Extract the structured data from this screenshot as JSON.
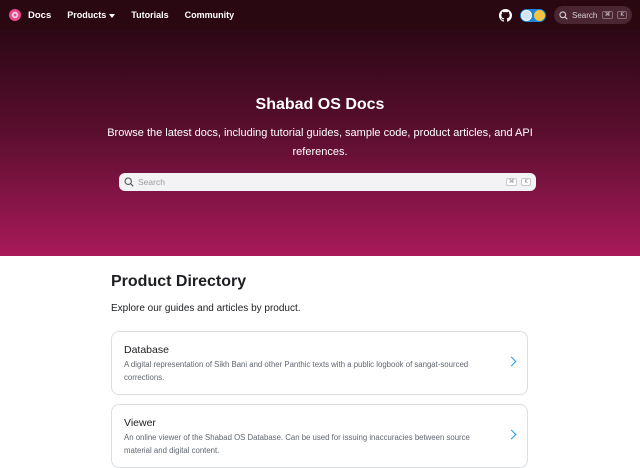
{
  "navbar": {
    "brand": "Docs",
    "items": [
      {
        "label": "Products"
      },
      {
        "label": "Tutorials"
      },
      {
        "label": "Community"
      }
    ],
    "search_placeholder": "Search",
    "search_keys": [
      "⌘",
      "K"
    ]
  },
  "hero": {
    "title": "Shabad OS Docs",
    "subtitle": "Browse the latest docs, including tutorial guides, sample code, product articles, and API references.",
    "search_placeholder": "Search",
    "search_keys": [
      "⌘",
      "K"
    ]
  },
  "directory": {
    "title": "Product Directory",
    "subtitle": "Explore our guides and articles by product.",
    "cards": [
      {
        "title": "Database",
        "description": "A digital representation of Sikh Bani and other Panthic texts with a public logbook of sangat-sourced corrections."
      },
      {
        "title": "Viewer",
        "description": "An online viewer of the Shabad OS Database. Can be used for issuing inaccuracies between source material and digital content."
      }
    ]
  },
  "colors": {
    "navbar_bg": "#2a0812",
    "hero_gradient_top": "#2c0815",
    "hero_gradient_bottom": "#a8195a",
    "link_accent": "#1d9bf0"
  },
  "icons": [
    "logo-icon",
    "caret-down-icon",
    "github-icon",
    "theme-toggle-icon",
    "search-icon",
    "chevron-right-icon"
  ]
}
